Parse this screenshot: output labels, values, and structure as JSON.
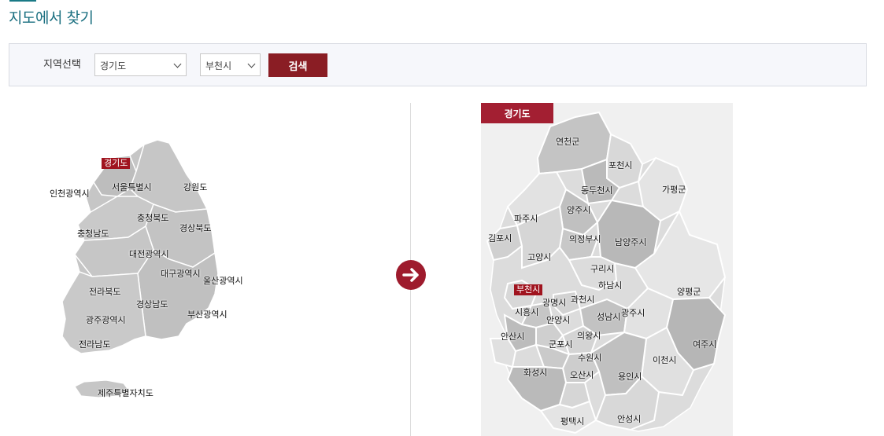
{
  "page": {
    "title": "지도에서 찾기"
  },
  "search": {
    "label": "지역선택",
    "province_value": "경기도",
    "city_value": "부천시",
    "button_label": "검색"
  },
  "korea_map": {
    "selected": "경기도",
    "labels": [
      "경기도",
      "서울특별시",
      "인천광역시",
      "강원도",
      "충청북도",
      "충청남도",
      "경상북도",
      "대전광역시",
      "대구광역시",
      "울산광역시",
      "전라북도",
      "경상남도",
      "광주광역시",
      "부산광역시",
      "전라남도",
      "제주특별자치도"
    ]
  },
  "gyeonggi_map": {
    "header": "경기도",
    "selected": "부천시",
    "labels": [
      "연천군",
      "포천시",
      "동두천시",
      "가평군",
      "양주시",
      "파주시",
      "김포시",
      "의정부시",
      "남양주시",
      "고양시",
      "구리시",
      "하남시",
      "양평군",
      "부천시",
      "광명시",
      "과천시",
      "시흥시",
      "안양시",
      "성남시",
      "광주시",
      "안산시",
      "의왕시",
      "군포시",
      "여주시",
      "수원시",
      "이천시",
      "화성시",
      "오산시",
      "용인시",
      "평택시",
      "안성시"
    ]
  },
  "colors": {
    "accent": "#8a1d24",
    "title": "#1a6f80",
    "map_fill": "#c8c8c8"
  }
}
